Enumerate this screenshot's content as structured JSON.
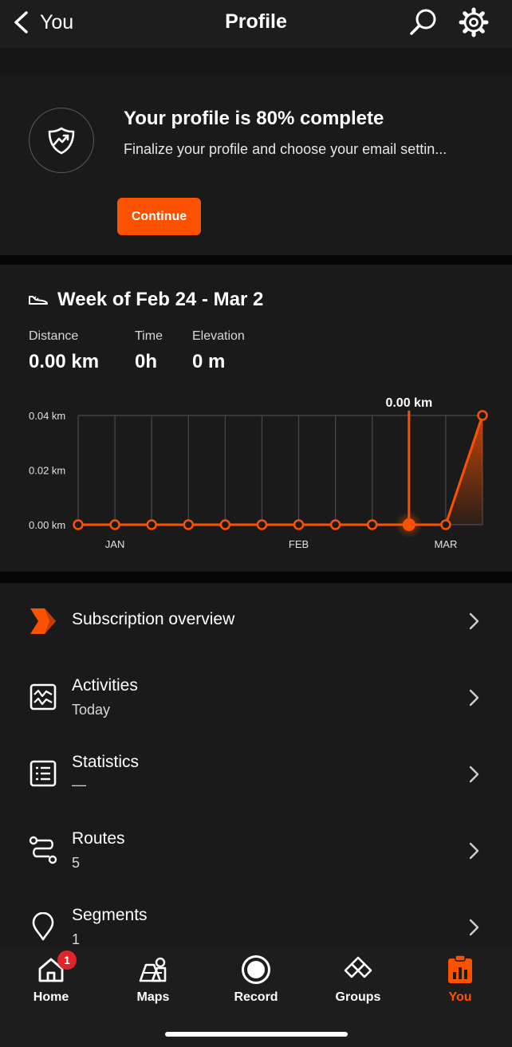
{
  "header": {
    "back_label": "You",
    "title": "Profile"
  },
  "profile_card": {
    "title": "Your profile is 80% complete",
    "description": "Finalize your profile and choose your email settin...",
    "button_label": "Continue"
  },
  "weekly": {
    "title": "Week of Feb 24 - Mar 2",
    "stats": [
      {
        "label": "Distance",
        "value": "0.00 km"
      },
      {
        "label": "Time",
        "value": "0h"
      },
      {
        "label": "Elevation",
        "value": "0 m"
      }
    ]
  },
  "chart_data": {
    "type": "line",
    "title": "",
    "xlabel": "",
    "ylabel": "",
    "y_tick_labels": [
      "0.04 km",
      "0.02 km",
      "0.00 km"
    ],
    "x_tick_labels": [
      "JAN",
      "FEB",
      "MAR"
    ],
    "ylim": [
      0,
      0.04
    ],
    "grid": true,
    "highlight_label": "0.00 km",
    "highlight_index": 9,
    "series": [
      {
        "values": [
          0,
          0,
          0,
          0,
          0,
          0,
          0,
          0,
          0,
          0,
          0,
          0.04
        ]
      }
    ],
    "accent": "#fc5200"
  },
  "menu": [
    {
      "icon": "subscription-chevron-icon",
      "title": "Subscription overview",
      "subtitle": ""
    },
    {
      "icon": "activities-icon",
      "title": "Activities",
      "subtitle": "Today"
    },
    {
      "icon": "statistics-icon",
      "title": "Statistics",
      "subtitle": "—"
    },
    {
      "icon": "routes-icon",
      "title": "Routes",
      "subtitle": "5"
    },
    {
      "icon": "segments-pin-icon",
      "title": "Segments",
      "subtitle": "1"
    }
  ],
  "nav": {
    "items": [
      {
        "label": "Home",
        "icon": "home-icon",
        "badge": "1"
      },
      {
        "label": "Maps",
        "icon": "maps-icon"
      },
      {
        "label": "Record",
        "icon": "record-icon"
      },
      {
        "label": "Groups",
        "icon": "groups-icon"
      },
      {
        "label": "You",
        "icon": "you-icon",
        "active": true
      }
    ]
  },
  "colors": {
    "accent": "#fc5200",
    "background": "#121212",
    "card": "#1a1a1a",
    "badge": "#e0242c"
  }
}
